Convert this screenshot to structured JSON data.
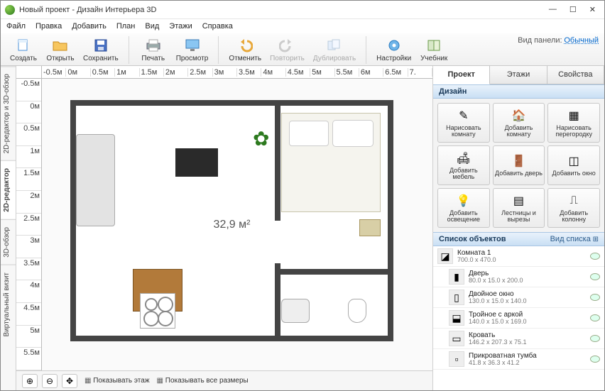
{
  "window": {
    "title": "Новый проект - Дизайн Интерьера 3D"
  },
  "menubar": [
    "Файл",
    "Правка",
    "Добавить",
    "План",
    "Вид",
    "Этажи",
    "Справка"
  ],
  "panel_mode": {
    "label": "Вид панели:",
    "value": "Обычный"
  },
  "toolbar": {
    "create": "Создать",
    "open": "Открыть",
    "save": "Сохранить",
    "print": "Печать",
    "view": "Просмотр",
    "undo": "Отменить",
    "redo": "Повторить",
    "duplicate": "Дублировать",
    "settings": "Настройки",
    "tutorial": "Учебник"
  },
  "ruler_h": [
    "-0.5м",
    "0м",
    "0.5м",
    "1м",
    "1.5м",
    "2м",
    "2.5м",
    "3м",
    "3.5м",
    "4м",
    "4.5м",
    "5м",
    "5.5м",
    "6м",
    "6.5м",
    "7."
  ],
  "ruler_v": [
    "-0.5м",
    "0м",
    "0.5м",
    "1м",
    "1.5м",
    "2м",
    "2.5м",
    "3м",
    "3.5м",
    "4м",
    "4.5м",
    "5м",
    "5.5м"
  ],
  "side_tabs": {
    "combo": "2D-редактор и 3D-обзор",
    "editor": "2D-редактор",
    "view3d": "3D-обзор",
    "virtual": "Виртуальный визит"
  },
  "area_label": "32,9 м²",
  "statusbar": {
    "show_floor": "Показывать этаж",
    "show_all": "Показывать все размеры"
  },
  "right_tabs": [
    "Проект",
    "Этажи",
    "Свойства"
  ],
  "design": {
    "header": "Дизайн",
    "buttons": [
      "Нарисовать комнату",
      "Добавить комнату",
      "Нарисовать перегородку",
      "Добавить мебель",
      "Добавить дверь",
      "Добавить окно",
      "Добавить освещение",
      "Лестницы и вырезы",
      "Добавить колонну"
    ]
  },
  "objects": {
    "header": "Список объектов",
    "meta": "Вид списка",
    "items": [
      {
        "name": "Комната 1",
        "dims": "700.0 x 470.0",
        "child": false
      },
      {
        "name": "Дверь",
        "dims": "80.0 x 15.0 x 200.0",
        "child": true
      },
      {
        "name": "Двойное окно",
        "dims": "130.0 x 15.0 x 140.0",
        "child": true
      },
      {
        "name": "Тройное с аркой",
        "dims": "140.0 x 15.0 x 169.0",
        "child": true
      },
      {
        "name": "Кровать",
        "dims": "146.2 x 207.3 x 75.1",
        "child": true
      },
      {
        "name": "Прикроватная тумба",
        "dims": "41.8 x 36.3 x 41.2",
        "child": true
      }
    ]
  }
}
